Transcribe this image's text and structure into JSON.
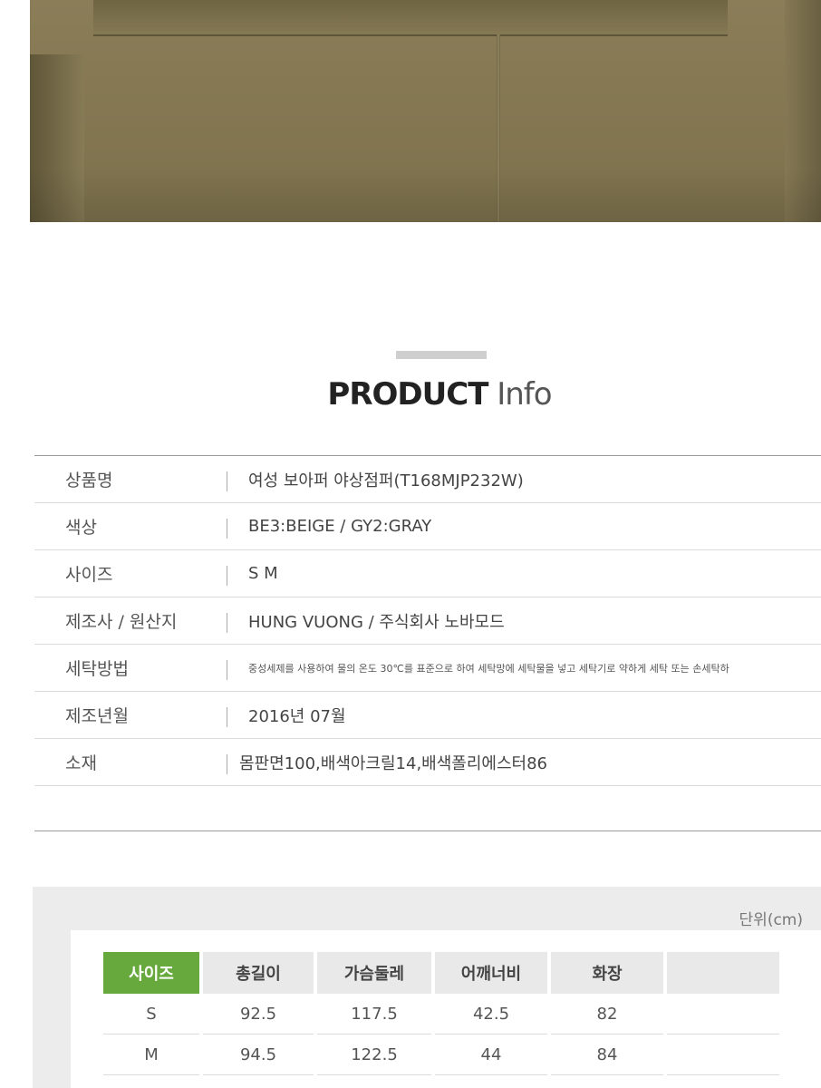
{
  "product_photo": {
    "alt": ""
  },
  "title": {
    "bold": "PRODUCT",
    "thin": "Info"
  },
  "info_rows": [
    {
      "label": "상품명",
      "value": "여성 보아퍼 야상점퍼(T168MJP232W)"
    },
    {
      "label": "색상",
      "value": "BE3:BEIGE / GY2:GRAY"
    },
    {
      "label": "사이즈",
      "value": "S M"
    },
    {
      "label": "제조사 / 원산지",
      "value": "HUNG VUONG / 주식회사 노바모드"
    },
    {
      "label": "세탁방법",
      "value": "중성세제를 사용하여 물의 온도 30℃를 표준으로 하여 세탁망에 세탁물을 넣고 세탁기로 약하게 세탁 또는 손세탁하"
    },
    {
      "label": "제조년월",
      "value": "2016년 07월"
    },
    {
      "label": "소재",
      "value": "몸판면100,배색아크릴14,배색폴리에스터86"
    }
  ],
  "size_table": {
    "unit": "단위(cm)",
    "headers": [
      "사이즈",
      "총길이",
      "가슴둘레",
      "어깨너비",
      "화장",
      ""
    ],
    "rows": [
      [
        "S",
        "92.5",
        "117.5",
        "42.5",
        "82",
        ""
      ],
      [
        "M",
        "94.5",
        "122.5",
        "44",
        "84",
        ""
      ]
    ]
  }
}
